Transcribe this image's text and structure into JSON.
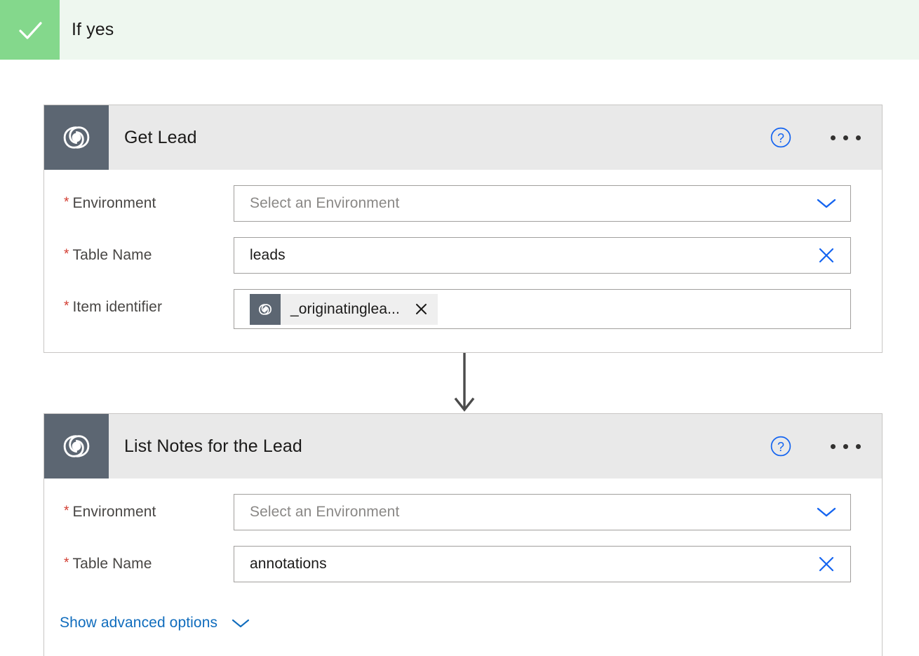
{
  "branch": {
    "label": "If yes",
    "icon": "check-icon",
    "accent_color": "#84d88c",
    "background_color": "#eef7ef"
  },
  "connector": {
    "icon": "arrow-down-icon",
    "color": "#4b4b4b"
  },
  "theme": {
    "card_header_bg": "#e9e9e9",
    "icon_tile_bg": "#5c6672",
    "link_blue": "#0f6cbd",
    "accent_blue": "#1464f0",
    "required_red": "#d23b2f",
    "border_gray": "#a19f9d",
    "card_border": "#c8c6c4"
  },
  "cards": [
    {
      "id": "get-lead",
      "title": "Get Lead",
      "icon": "dataverse-icon",
      "help_icon": "help-circle-icon",
      "menu_icon": "ellipsis-icon",
      "fields": [
        {
          "label": "Environment",
          "required": true,
          "value": "",
          "placeholder": "Select an Environment",
          "control": "dropdown",
          "action_icon": "chevron-down-icon"
        },
        {
          "label": "Table Name",
          "required": true,
          "value": "leads",
          "placeholder": "",
          "control": "text",
          "action_icon": "clear-x-icon"
        },
        {
          "label": "Item identifier",
          "required": true,
          "value": "",
          "placeholder": "",
          "control": "token",
          "token": {
            "icon": "dataverse-icon",
            "label": "_originatinglea...",
            "remove_icon": "close-x-icon"
          }
        }
      ],
      "advanced_options": null
    },
    {
      "id": "list-notes-for-the-lead",
      "title": "List Notes for the Lead",
      "icon": "dataverse-icon",
      "help_icon": "help-circle-icon",
      "menu_icon": "ellipsis-icon",
      "fields": [
        {
          "label": "Environment",
          "required": true,
          "value": "",
          "placeholder": "Select an Environment",
          "control": "dropdown",
          "action_icon": "chevron-down-icon"
        },
        {
          "label": "Table Name",
          "required": true,
          "value": "annotations",
          "placeholder": "",
          "control": "text",
          "action_icon": "clear-x-icon"
        }
      ],
      "advanced_options": {
        "label": "Show advanced options",
        "icon": "chevron-down-icon"
      }
    }
  ]
}
